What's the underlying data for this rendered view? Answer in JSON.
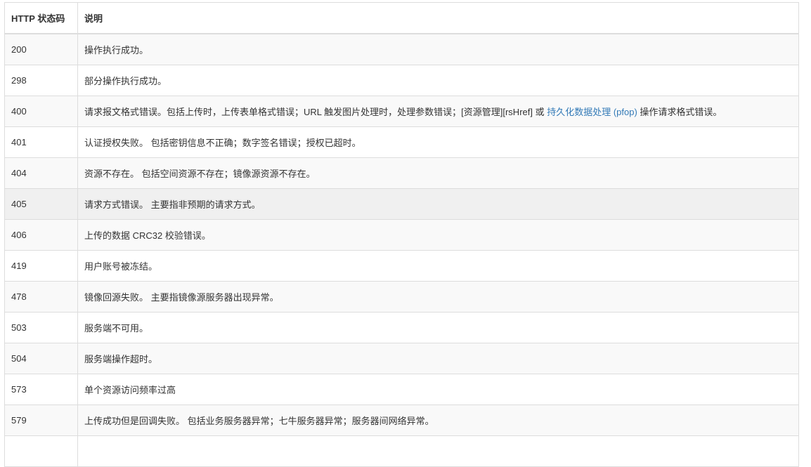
{
  "table": {
    "headers": [
      "HTTP 状态码",
      "说明"
    ],
    "rows": [
      {
        "code": "200",
        "desc": "操作执行成功。"
      },
      {
        "code": "298",
        "desc": "部分操作执行成功。"
      },
      {
        "code": "400",
        "desc_before": "请求报文格式错误。包括上传时，上传表单格式错误；URL 触发图片处理时，处理参数错误；[资源管理][rsHref] 或 ",
        "desc_link": "持久化数据处理 (pfop)",
        "desc_after": " 操作请求格式错误。"
      },
      {
        "code": "401",
        "desc": "认证授权失败。 包括密钥信息不正确；数字签名错误；授权已超时。"
      },
      {
        "code": "404",
        "desc": "资源不存在。 包括空间资源不存在；镜像源资源不存在。"
      },
      {
        "code": "405",
        "desc": "请求方式错误。 主要指非预期的请求方式。"
      },
      {
        "code": "406",
        "desc": "上传的数据 CRC32 校验错误。"
      },
      {
        "code": "419",
        "desc": "用户账号被冻结。"
      },
      {
        "code": "478",
        "desc": "镜像回源失败。 主要指镜像源服务器出现异常。"
      },
      {
        "code": "503",
        "desc": "服务端不可用。"
      },
      {
        "code": "504",
        "desc": "服务端操作超时。"
      },
      {
        "code": "573",
        "desc": "单个资源访问频率过高"
      },
      {
        "code": "579",
        "desc": "上传成功但是回调失败。 包括业务服务器异常；七牛服务器异常；服务器间网络异常。"
      }
    ]
  }
}
